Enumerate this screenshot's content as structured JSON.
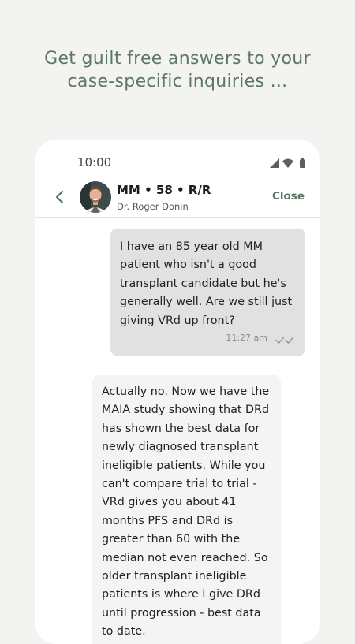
{
  "headline": {
    "line1": "Get guilt free answers to your",
    "line2": "case-specific inquiries ..."
  },
  "status_bar": {
    "time": "10:00",
    "icons": [
      "signal-icon",
      "wifi-icon",
      "battery-icon"
    ]
  },
  "chat_header": {
    "back_icon": "chevron-left-icon",
    "title": "MM • 58 • R/R",
    "subtitle": "Dr. Roger Donin",
    "close_label": "Close"
  },
  "messages": [
    {
      "direction": "outgoing",
      "text": "I have an 85 year old MM patient who isn't a good transplant candidate but he's generally well. Are we still just giving VRd up front?",
      "time": "11:27 am",
      "status_icon": "double-check-icon"
    },
    {
      "direction": "incoming",
      "text": "Actually no. Now we have the MAIA study showing that DRd has shown the best data for newly diagnosed transplant ineligible patients. While you can't compare trial to trial - VRd gives you about 41 months PFS and DRd is greater than 60 with the median not even reached. So older transplant ineligible patients is where I give DRd until progression - best data to date."
    }
  ],
  "colors": {
    "accent": "#5d7767",
    "page_bg": "#f3f3f1",
    "outgoing_bubble": "#e1e1e1",
    "incoming_bubble": "#f4f4f4"
  }
}
